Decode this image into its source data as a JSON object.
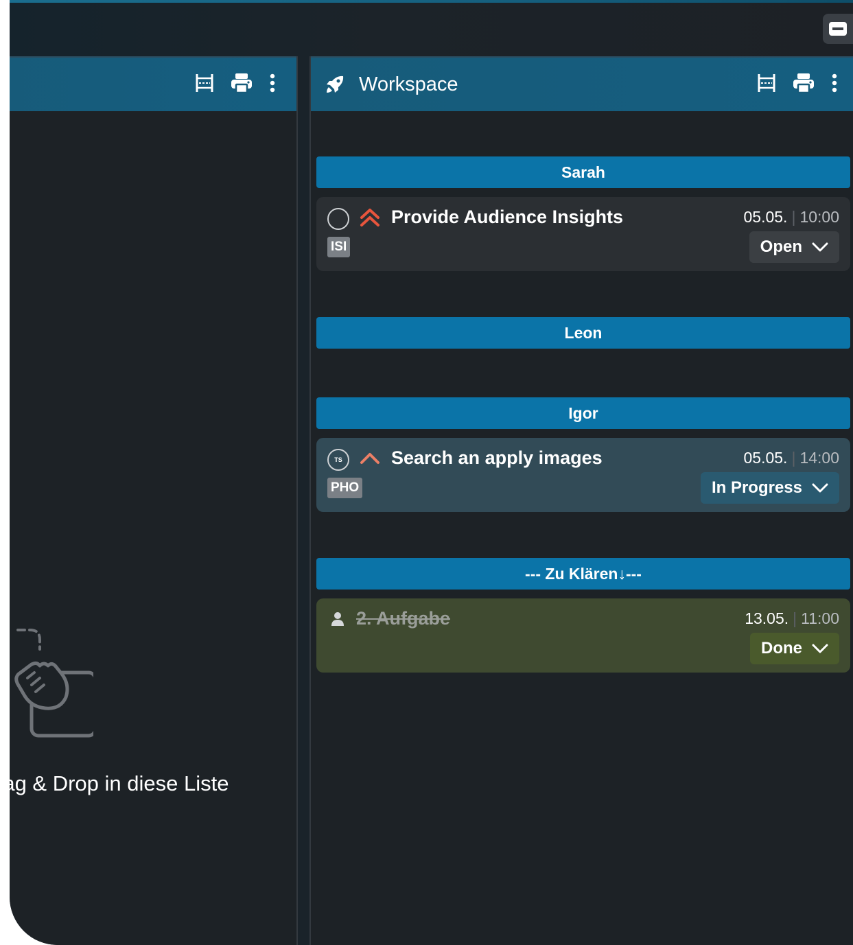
{
  "left_panel": {
    "drop_text": "rag & Drop in diese Liste"
  },
  "right_panel": {
    "title": "Workspace"
  },
  "groups": [
    {
      "name": "Sarah",
      "task": {
        "title": "Provide Audience Insights",
        "date": "05.05.",
        "time": "10:00",
        "tag": "ISI",
        "status": "Open"
      }
    },
    {
      "name": "Leon"
    },
    {
      "name": "Igor",
      "task": {
        "title": "Search an apply images",
        "date": "05.05.",
        "time": "14:00",
        "tag": "PHO",
        "status": "In Progress",
        "avatar_initials": "TS"
      }
    },
    {
      "name": "--- Zu Klären↓---",
      "task": {
        "title": "2. Aufgabe",
        "date": "13.05.",
        "time": "11:00",
        "status": "Done"
      }
    }
  ],
  "colors": {
    "group_bar": "#0b74a8",
    "priority_high": "#e8553d",
    "priority_medium": "#ec7f66",
    "card_open": "#2b2f33",
    "card_in_progress": "#324b57",
    "card_done": "#3f4a30"
  }
}
